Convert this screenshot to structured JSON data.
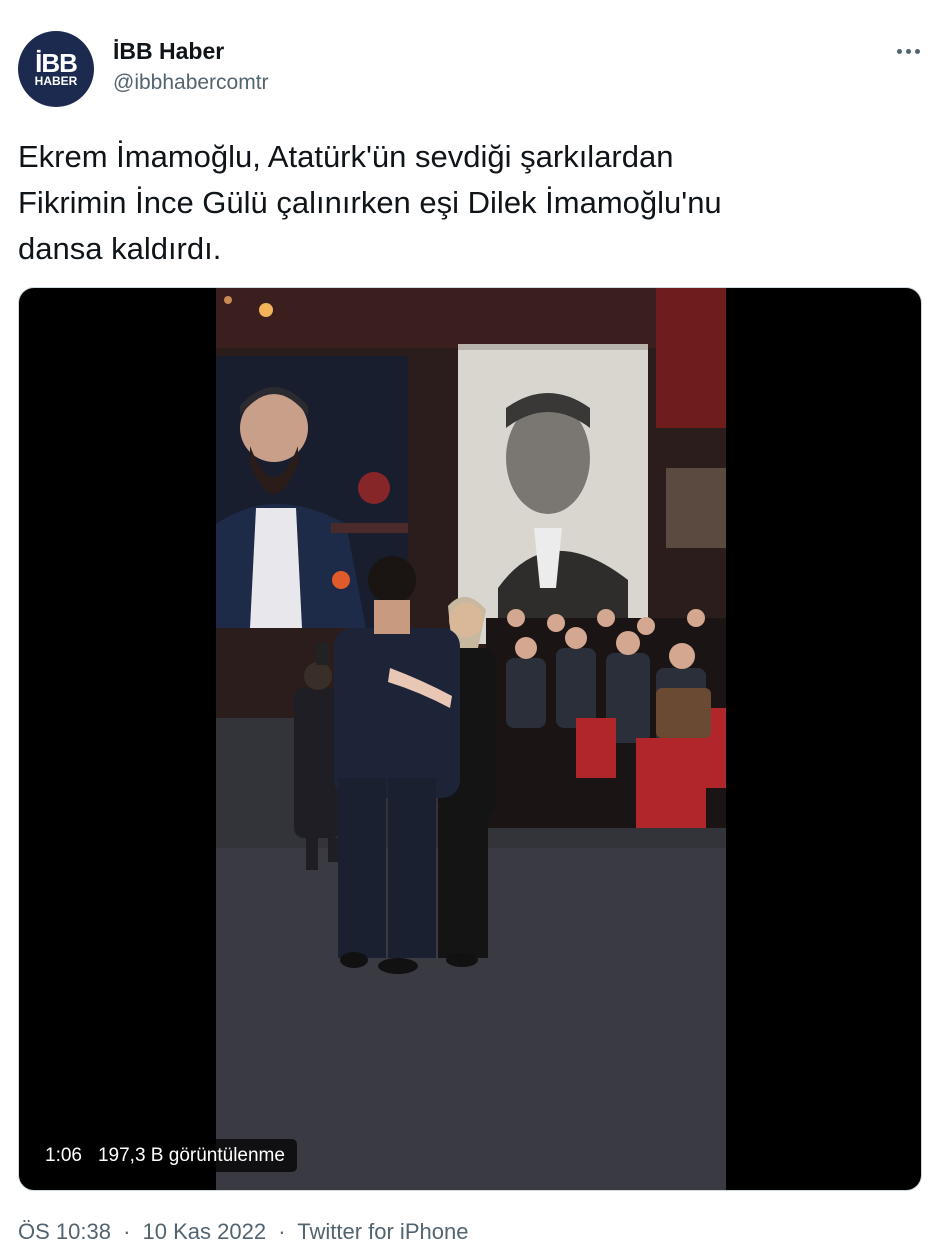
{
  "author": {
    "name": "İBB Haber",
    "handle": "@ibbhabercomtr",
    "avatar_logo_top": "İBB",
    "avatar_logo_bottom": "HABER"
  },
  "tweet": {
    "text_line1": "Ekrem İmamoğlu, Atatürk'ün sevdiği şarkılardan",
    "text_line2": "Fikrimin İnce Gülü çalınırken eşi Dilek İmamoğlu'nu",
    "text_line3": "dansa kaldırdı."
  },
  "video": {
    "duration": "1:06",
    "views": "197,3 B görüntülenme"
  },
  "meta": {
    "time": "ÖS 10:38",
    "date": "10 Kas 2022",
    "source": "Twitter for iPhone",
    "separator": "·"
  },
  "colors": {
    "brand_navy": "#1b2a4e",
    "secondary_text": "#536471",
    "primary_text": "#0f1419"
  }
}
